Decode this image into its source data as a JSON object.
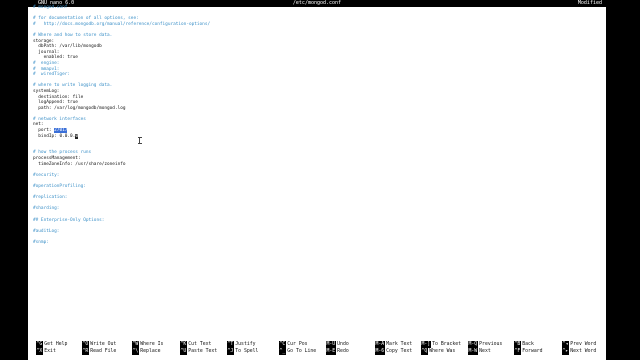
{
  "titlebar": {
    "version": "GNU nano 6.0",
    "filename": "/etc/mongod.conf",
    "status": "Modified"
  },
  "editor": {
    "lines_before_port": [
      {
        "t": "# mongod.conf",
        "c": true
      },
      {
        "t": "",
        "c": false
      },
      {
        "t": "# for documentation of all options, see:",
        "c": true
      },
      {
        "t": "#   http://docs.mongodb.org/manual/reference/configuration-options/",
        "c": true
      },
      {
        "t": "",
        "c": false
      },
      {
        "t": "# Where and how to store data.",
        "c": true
      },
      {
        "t": "storage:",
        "c": false
      },
      {
        "t": "  dbPath: /var/lib/mongodb",
        "c": false
      },
      {
        "t": "  journal:",
        "c": false
      },
      {
        "t": "    enabled: true",
        "c": false
      },
      {
        "t": "#  engine:",
        "c": true
      },
      {
        "t": "#  mmapv1:",
        "c": true
      },
      {
        "t": "#  wiredTiger:",
        "c": true
      },
      {
        "t": "",
        "c": false
      },
      {
        "t": "# where to write logging data.",
        "c": true
      },
      {
        "t": "systemLog:",
        "c": false
      },
      {
        "t": "  destination: file",
        "c": false
      },
      {
        "t": "  logAppend: true",
        "c": false
      },
      {
        "t": "  path: /var/log/mongodb/mongod.log",
        "c": false
      },
      {
        "t": "",
        "c": false
      },
      {
        "t": "# network interfaces",
        "c": true
      },
      {
        "t": "net:",
        "c": false
      }
    ],
    "port_prefix": "  port: ",
    "port_value": "27017",
    "bind_prefix": "  bindIp: ",
    "bind_value": "0.0.0.",
    "bind_cursor": "0",
    "lines_after_bind": [
      {
        "t": "",
        "c": false
      },
      {
        "t": "",
        "c": false
      },
      {
        "t": "# how the process runs",
        "c": true
      },
      {
        "t": "processManagement:",
        "c": false
      },
      {
        "t": "  timeZoneInfo: /usr/share/zoneinfo",
        "c": false
      },
      {
        "t": "",
        "c": false
      },
      {
        "t": "#security:",
        "c": true
      },
      {
        "t": "",
        "c": false
      },
      {
        "t": "#operationProfiling:",
        "c": true
      },
      {
        "t": "",
        "c": false
      },
      {
        "t": "#replication:",
        "c": true
      },
      {
        "t": "",
        "c": false
      },
      {
        "t": "#sharding:",
        "c": true
      },
      {
        "t": "",
        "c": false
      },
      {
        "t": "## Enterprise-Only Options:",
        "c": true
      },
      {
        "t": "",
        "c": false
      },
      {
        "t": "#auditLog:",
        "c": true
      },
      {
        "t": "",
        "c": false
      },
      {
        "t": "#snmp:",
        "c": true
      }
    ]
  },
  "shortcuts": {
    "row1": [
      {
        "key": "^G",
        "label": "Get Help"
      },
      {
        "key": "^O",
        "label": "Write Out"
      },
      {
        "key": "^W",
        "label": "Where Is"
      },
      {
        "key": "^K",
        "label": "Cut Text"
      },
      {
        "key": "^T",
        "label": "Justify"
      },
      {
        "key": "^C",
        "label": "Cur Pos"
      },
      {
        "key": "M-U",
        "label": "Undo"
      },
      {
        "key": "M-A",
        "label": "Mark Text"
      },
      {
        "key": "M-]",
        "label": "To Bracket"
      },
      {
        "key": "M-Q",
        "label": "Previous"
      },
      {
        "key": "^B",
        "label": "Back"
      },
      {
        "key": "^◂",
        "label": "Prev Word"
      }
    ],
    "row2": [
      {
        "key": "^X",
        "label": "Exit"
      },
      {
        "key": "^R",
        "label": "Read File"
      },
      {
        "key": "^\\",
        "label": "Replace"
      },
      {
        "key": "^U",
        "label": "Paste Text"
      },
      {
        "key": "^J",
        "label": "To Spell"
      },
      {
        "key": "^_",
        "label": "Go To Line"
      },
      {
        "key": "M-E",
        "label": "Redo"
      },
      {
        "key": "M-6",
        "label": "Copy Text"
      },
      {
        "key": "^Q",
        "label": "Where Was"
      },
      {
        "key": "M-W",
        "label": "Next"
      },
      {
        "key": "^F",
        "label": "Forward"
      },
      {
        "key": "^▸",
        "label": "Next Word"
      }
    ]
  }
}
